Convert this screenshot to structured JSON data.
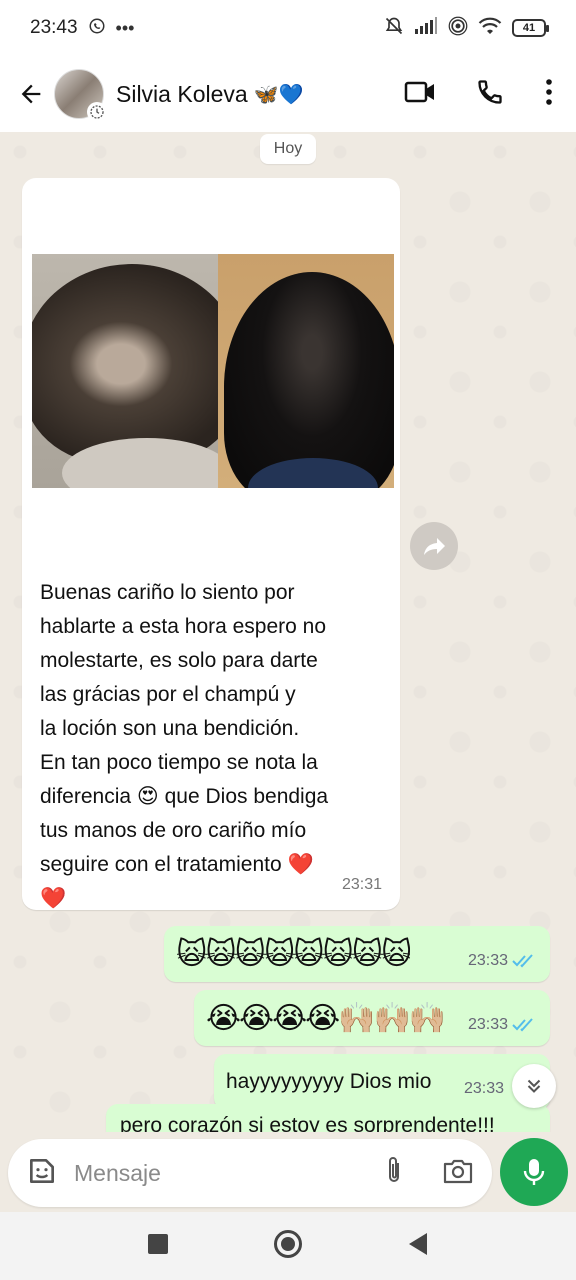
{
  "status_bar": {
    "time": "23:43",
    "battery": "41"
  },
  "header": {
    "contact_name": "Silvia Koleva",
    "name_emoji": "🦋💙"
  },
  "chat": {
    "date_chip": "Hoy",
    "incoming": {
      "text": "Buenas cariño lo siento por\nhablarte a esta hora espero no\nmolestarte, es solo para darte\nlas grácias por el champú y\nla loción son una bendición.\nEn tan poco tiempo se nota la\ndiferencia 😍 que Dios bendiga\ntus manos de oro cariño mío\nseguire con el tratamiento ❤️\n❤️",
      "time": "23:31"
    },
    "outgoing": [
      {
        "text": "🙀🙀🙀🙀🙀🙀🙀🙀",
        "time": "23:33"
      },
      {
        "text": "😭😭😭😭🙌🏼🙌🏼🙌🏼",
        "time": "23:33"
      },
      {
        "text": "hayyyyyyyyy Dios mio",
        "time": "23:33"
      },
      {
        "text": "pero corazón si estoy es sorprendente!!!",
        "time": ""
      }
    ]
  },
  "composer": {
    "placeholder": "Mensaje"
  },
  "colors": {
    "accent": "#1fa855",
    "outgoing_bubble": "#d9fdd3",
    "read_ticks": "#53bdeb"
  }
}
